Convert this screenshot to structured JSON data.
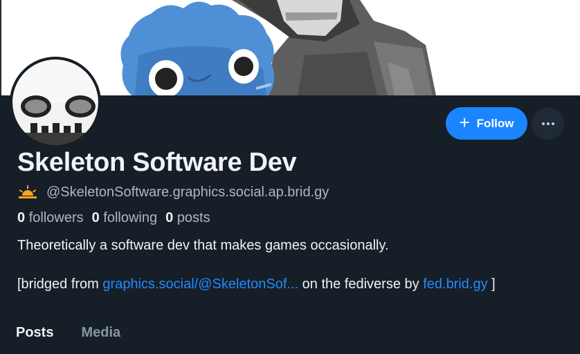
{
  "profile": {
    "display_name": "Skeleton Software Dev",
    "handle": "@SkeletonSoftware.graphics.social.ap.brid.gy",
    "handle_badge_icon": "sunrise-icon",
    "bio": "Theoretically a software dev that makes games occasionally."
  },
  "stats": {
    "followers_count": "0",
    "followers_label": "followers",
    "following_count": "0",
    "following_label": "following",
    "posts_count": "0",
    "posts_label": "posts"
  },
  "bridge": {
    "prefix": "[bridged from",
    "source_link": "graphics.social/@SkeletonSof...",
    "middle": "on the fediverse by",
    "bridge_link": "fed.brid.gy",
    "suffix": "]"
  },
  "actions": {
    "follow_label": "Follow",
    "follow_icon": "plus-icon",
    "more_icon": "ellipsis-icon"
  },
  "tabs": [
    {
      "label": "Posts",
      "active": true
    },
    {
      "label": "Media",
      "active": false
    }
  ],
  "colors": {
    "background": "#161e27",
    "accent": "#1a85ff",
    "link": "#208bfe",
    "text_primary": "#f1f3f5",
    "text_secondary": "#aeb7c2",
    "badge": "#f5a623"
  }
}
